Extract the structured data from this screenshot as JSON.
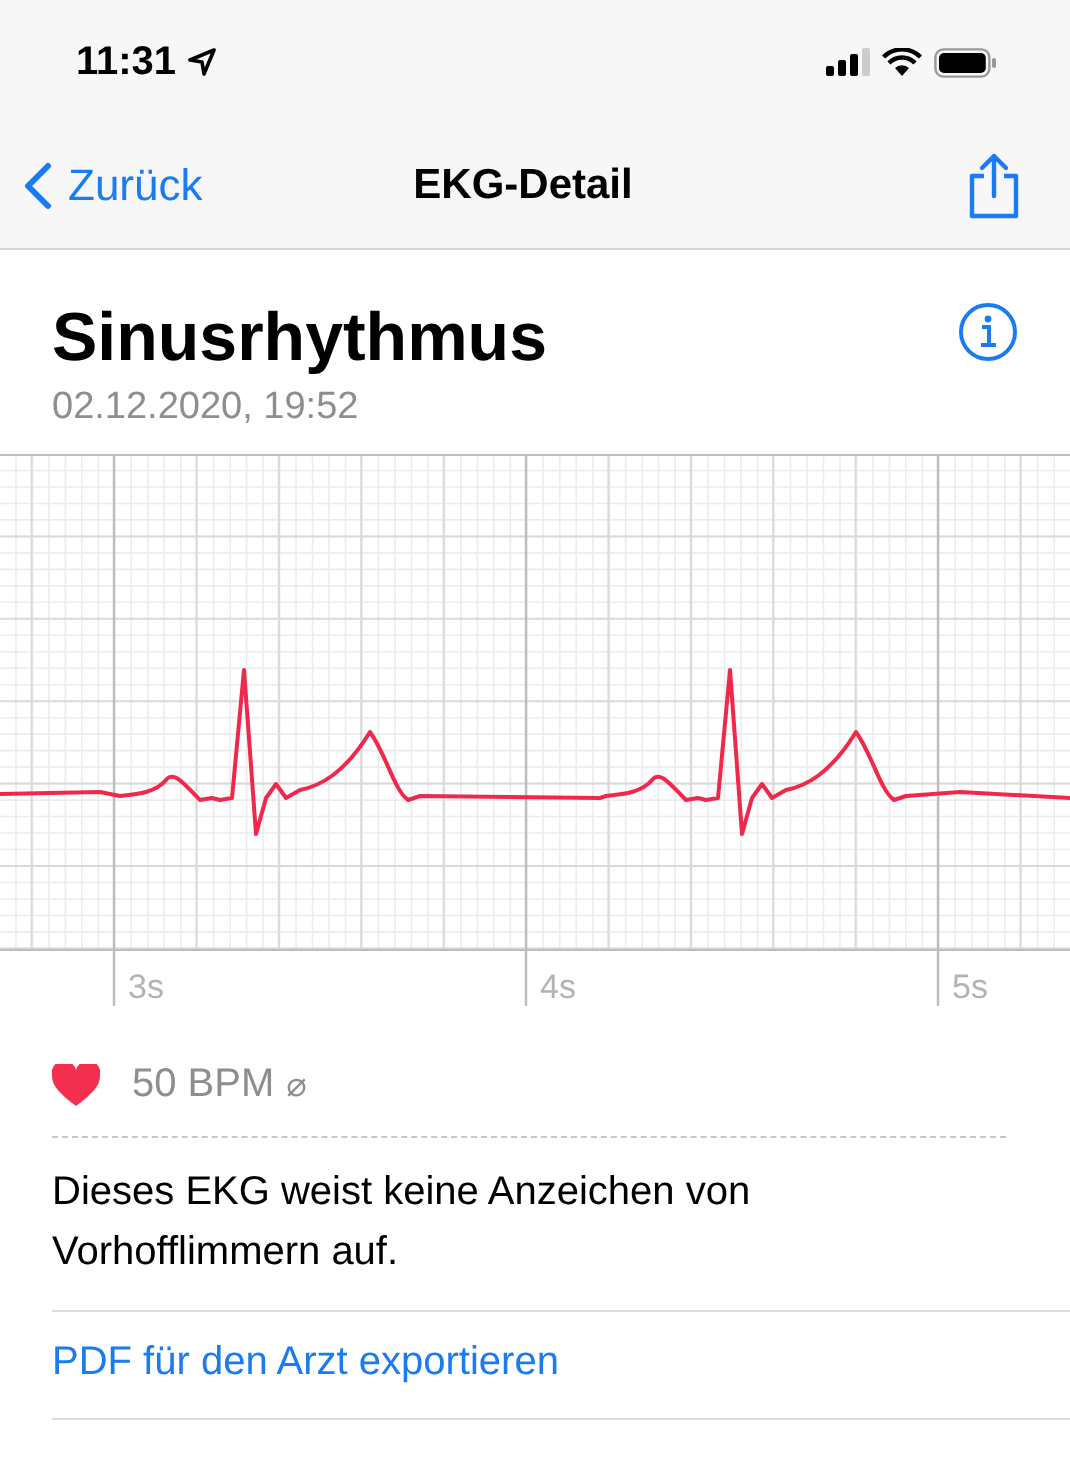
{
  "status_bar": {
    "time": "11:31"
  },
  "nav": {
    "back": "Zurück",
    "title": "EKG-Detail"
  },
  "header": {
    "title": "Sinusrhythmus",
    "date": "02.12.2020, 19:52"
  },
  "ecg": {
    "time_labels": [
      "3s",
      "4s",
      "5s"
    ]
  },
  "heart_rate": {
    "value": "50 BPM",
    "symbol": "⌀"
  },
  "result": "Dieses EKG weist keine Anzeichen von Vorhofflimmern auf.",
  "export_link": "PDF für den Arzt exportieren"
}
